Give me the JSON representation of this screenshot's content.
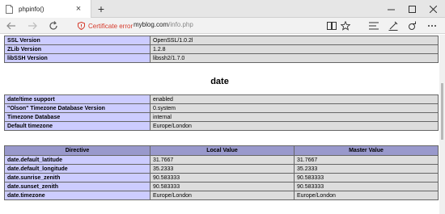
{
  "browser": {
    "tab_title": "phpinfo()",
    "tab_close": "×",
    "new_tab": "+",
    "cert_label": "Certificate error",
    "url_host": "myblog.com",
    "url_path": "/info.php"
  },
  "ssl_table": [
    {
      "key": "SSL Version",
      "value": "OpenSSL/1.0.2l"
    },
    {
      "key": "ZLib Version",
      "value": "1.2.8"
    },
    {
      "key": "libSSH Version",
      "value": "libssh2/1.7.0"
    }
  ],
  "date_section": {
    "title": "date",
    "info": [
      {
        "key": "date/time support",
        "value": "enabled"
      },
      {
        "key": "\"Olson\" Timezone Database Version",
        "value": "0.system"
      },
      {
        "key": "Timezone Database",
        "value": "internal"
      },
      {
        "key": "Default timezone",
        "value": "Europe/London"
      }
    ],
    "directives": {
      "headers": [
        "Directive",
        "Local Value",
        "Master Value"
      ],
      "rows": [
        [
          "date.default_latitude",
          "31.7667",
          "31.7667"
        ],
        [
          "date.default_longitude",
          "35.2333",
          "35.2333"
        ],
        [
          "date.sunrise_zenith",
          "90.583333",
          "90.583333"
        ],
        [
          "date.sunset_zenith",
          "90.583333",
          "90.583333"
        ],
        [
          "date.timezone",
          "Europe/London",
          "Europe/London"
        ]
      ]
    }
  }
}
